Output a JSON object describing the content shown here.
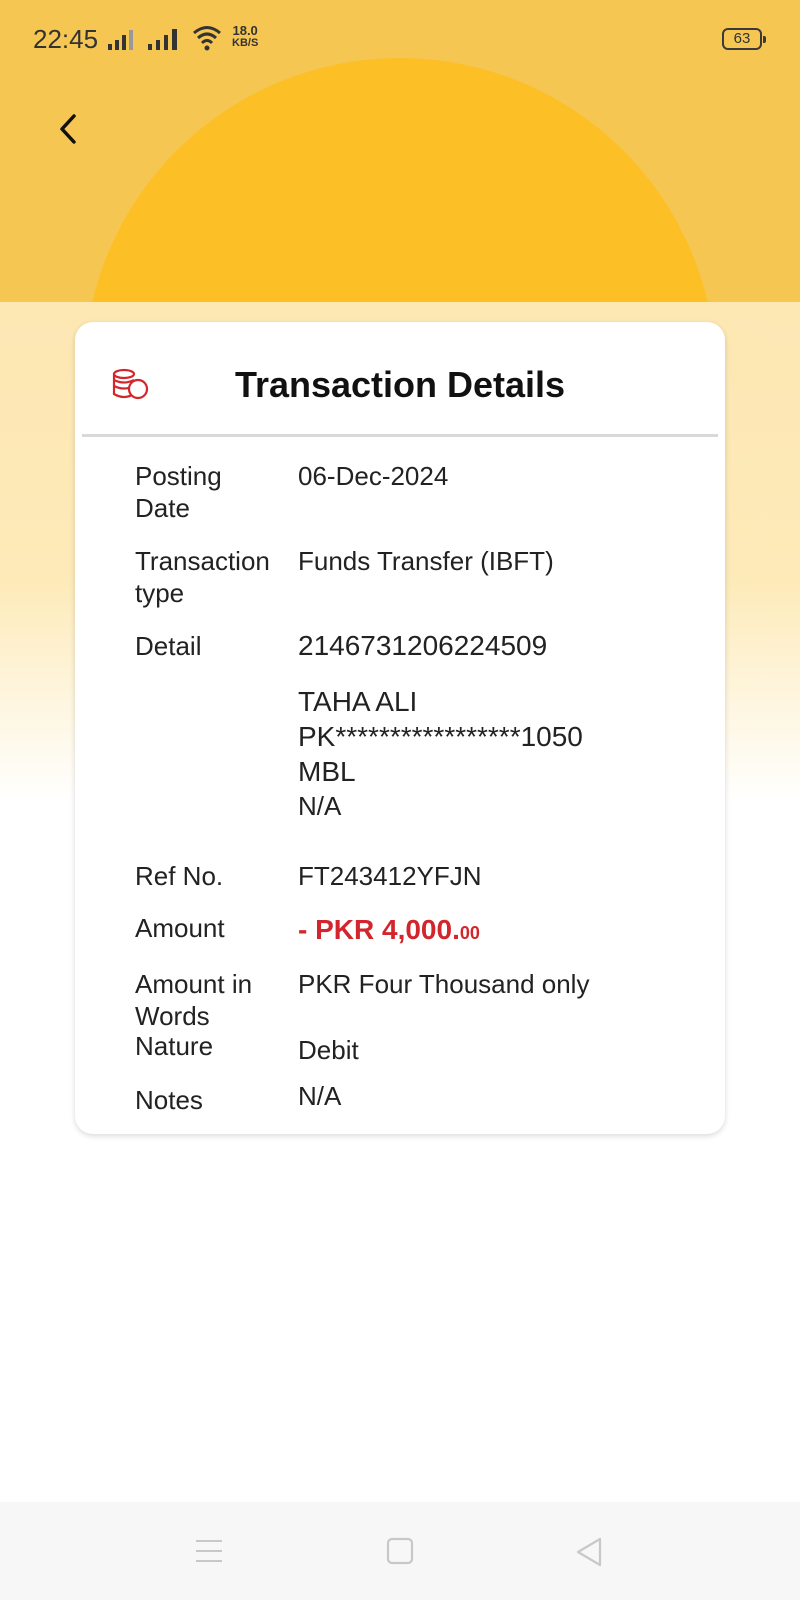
{
  "status_bar": {
    "time": "22:45",
    "speed_value": "18.0",
    "speed_unit": "KB/S",
    "battery": "63"
  },
  "card": {
    "title": "Transaction Details",
    "rows": {
      "posting_date": {
        "label_line1": "Posting",
        "label_line2": "Date",
        "value": "06-Dec-2024"
      },
      "transaction_type": {
        "label_line1": "Transaction",
        "label_line2": "type",
        "value": "Funds Transfer (IBFT)"
      },
      "detail": {
        "label": "Detail",
        "value_line1": "2146731206224509",
        "value_line2": "TAHA ALI",
        "value_line3": "PK*****************1050",
        "value_line4": "MBL",
        "value_line5": "N/A"
      },
      "ref_no": {
        "label": "Ref No.",
        "value": "FT243412YFJN"
      },
      "amount": {
        "label": "Amount",
        "value_main": "- PKR 4,000.",
        "value_decimal": "00"
      },
      "amount_words": {
        "label_line1": "Amount in",
        "label_line2": "Words",
        "value": "PKR Four Thousand only"
      },
      "nature": {
        "label": "Nature",
        "value": "Debit"
      },
      "notes": {
        "label": "Notes",
        "value": "N/A"
      }
    }
  },
  "colors": {
    "header_bg": "#f6c653",
    "sun": "#fcbf26",
    "accent_red": "#d3262c"
  },
  "icons": [
    "back-arrow-icon",
    "coins-icon",
    "menu-icon",
    "home-square-icon",
    "back-triangle-icon"
  ]
}
